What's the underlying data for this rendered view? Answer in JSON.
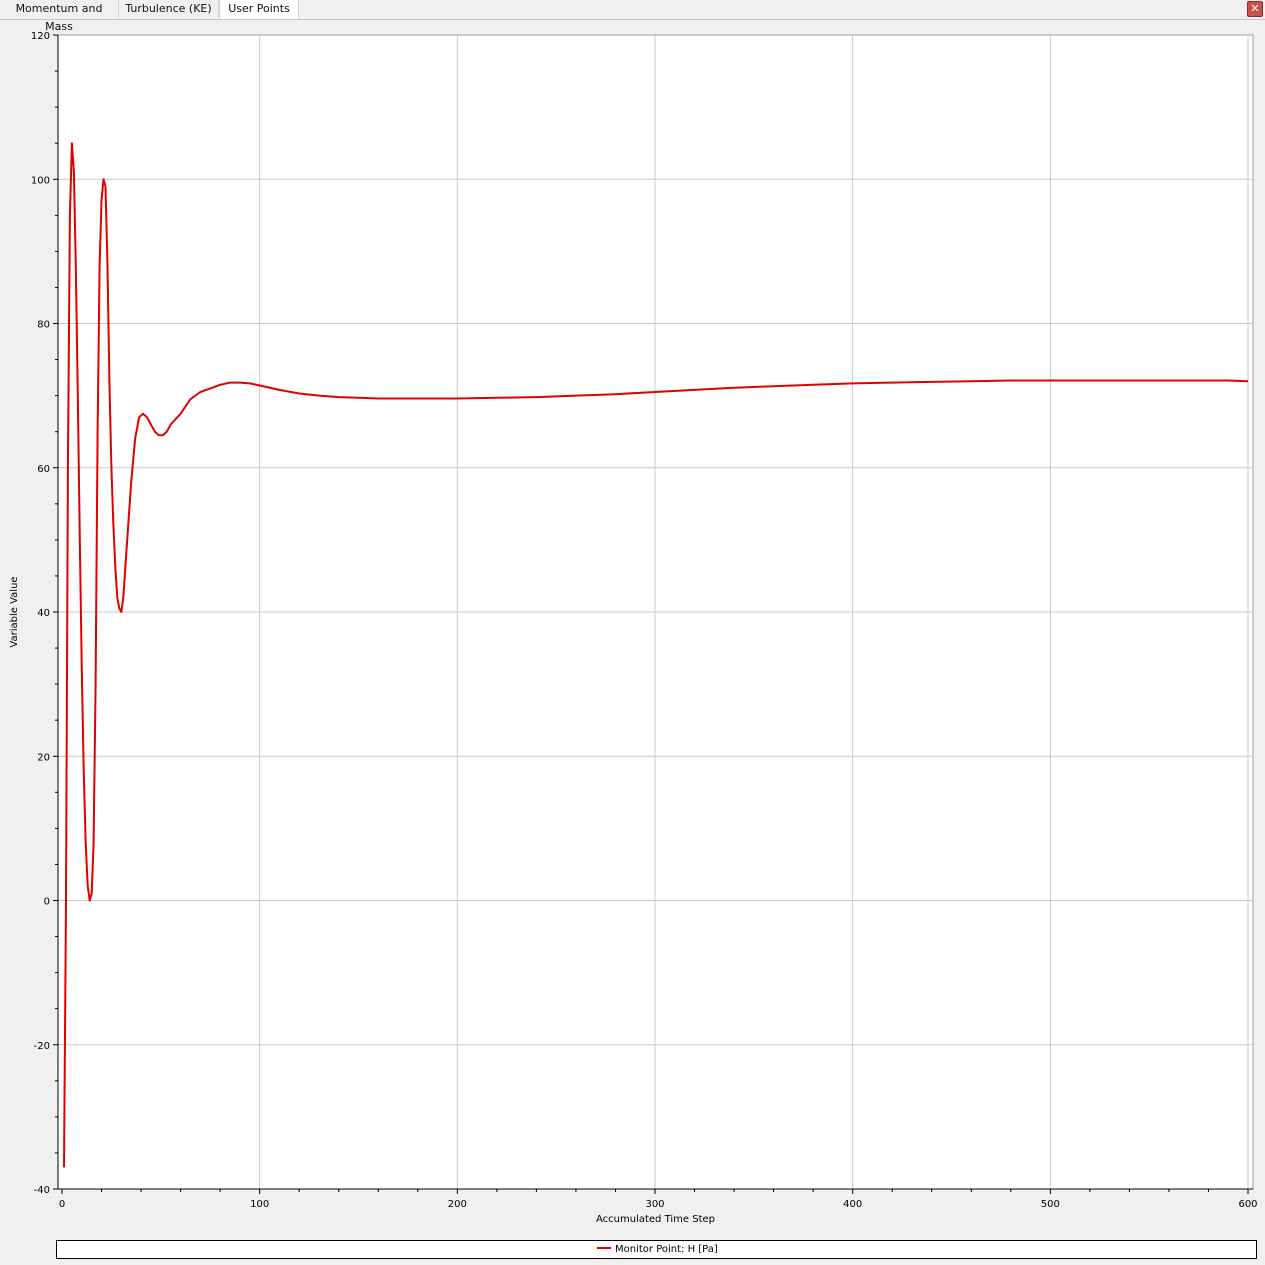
{
  "tabs": [
    {
      "label": "Momentum and Mass",
      "active": false
    },
    {
      "label": "Turbulence (KE)",
      "active": false
    },
    {
      "label": "User Points",
      "active": true
    }
  ],
  "close_icon": "close-icon",
  "colors": {
    "series": "#e00000",
    "grid": "#c8c8c8",
    "plot_bg": "#ffffff",
    "window_bg": "#f0f0f0"
  },
  "chart_data": {
    "type": "line",
    "title": "",
    "xlabel": "Accumulated Time Step",
    "ylabel": "Variable Value",
    "xlim": [
      0,
      600
    ],
    "ylim": [
      -40,
      120
    ],
    "xticks": [
      0,
      100,
      200,
      300,
      400,
      500,
      600
    ],
    "yticks": [
      -40,
      -20,
      0,
      20,
      40,
      60,
      80,
      100,
      120
    ],
    "grid": true,
    "legend_position": "bottom",
    "series": [
      {
        "name": "Monitor Point: H [Pa]",
        "color": "#e00000",
        "points": [
          [
            1,
            -37
          ],
          [
            2,
            0
          ],
          [
            3,
            60
          ],
          [
            4,
            95
          ],
          [
            5,
            105
          ],
          [
            6,
            101
          ],
          [
            7,
            88
          ],
          [
            8,
            70
          ],
          [
            9,
            50
          ],
          [
            10,
            32
          ],
          [
            11,
            18
          ],
          [
            12,
            8
          ],
          [
            13,
            2
          ],
          [
            14,
            0
          ],
          [
            15,
            1
          ],
          [
            16,
            8
          ],
          [
            17,
            30
          ],
          [
            18,
            65
          ],
          [
            19,
            88
          ],
          [
            20,
            97
          ],
          [
            21,
            100
          ],
          [
            22,
            99
          ],
          [
            23,
            88
          ],
          [
            24,
            72
          ],
          [
            25,
            60
          ],
          [
            26,
            52
          ],
          [
            27,
            46
          ],
          [
            28,
            42
          ],
          [
            29,
            40.5
          ],
          [
            30,
            40
          ],
          [
            31,
            42
          ],
          [
            33,
            50
          ],
          [
            35,
            58
          ],
          [
            37,
            64
          ],
          [
            39,
            67
          ],
          [
            41,
            67.5
          ],
          [
            43,
            67
          ],
          [
            45,
            66
          ],
          [
            47,
            65
          ],
          [
            49,
            64.5
          ],
          [
            51,
            64.5
          ],
          [
            53,
            65
          ],
          [
            55,
            66
          ],
          [
            60,
            67.5
          ],
          [
            65,
            69.5
          ],
          [
            70,
            70.5
          ],
          [
            75,
            71
          ],
          [
            80,
            71.5
          ],
          [
            85,
            71.8
          ],
          [
            90,
            71.8
          ],
          [
            95,
            71.7
          ],
          [
            100,
            71.4
          ],
          [
            110,
            70.8
          ],
          [
            120,
            70.3
          ],
          [
            130,
            70
          ],
          [
            140,
            69.8
          ],
          [
            150,
            69.7
          ],
          [
            160,
            69.6
          ],
          [
            170,
            69.6
          ],
          [
            180,
            69.6
          ],
          [
            190,
            69.6
          ],
          [
            200,
            69.6
          ],
          [
            220,
            69.7
          ],
          [
            240,
            69.8
          ],
          [
            260,
            70
          ],
          [
            280,
            70.2
          ],
          [
            300,
            70.5
          ],
          [
            320,
            70.8
          ],
          [
            340,
            71.1
          ],
          [
            360,
            71.3
          ],
          [
            380,
            71.5
          ],
          [
            400,
            71.7
          ],
          [
            420,
            71.8
          ],
          [
            440,
            71.9
          ],
          [
            460,
            72
          ],
          [
            480,
            72.1
          ],
          [
            500,
            72.1
          ],
          [
            520,
            72.1
          ],
          [
            540,
            72.1
          ],
          [
            560,
            72.1
          ],
          [
            580,
            72.1
          ],
          [
            590,
            72.1
          ],
          [
            600,
            72
          ]
        ]
      }
    ]
  }
}
